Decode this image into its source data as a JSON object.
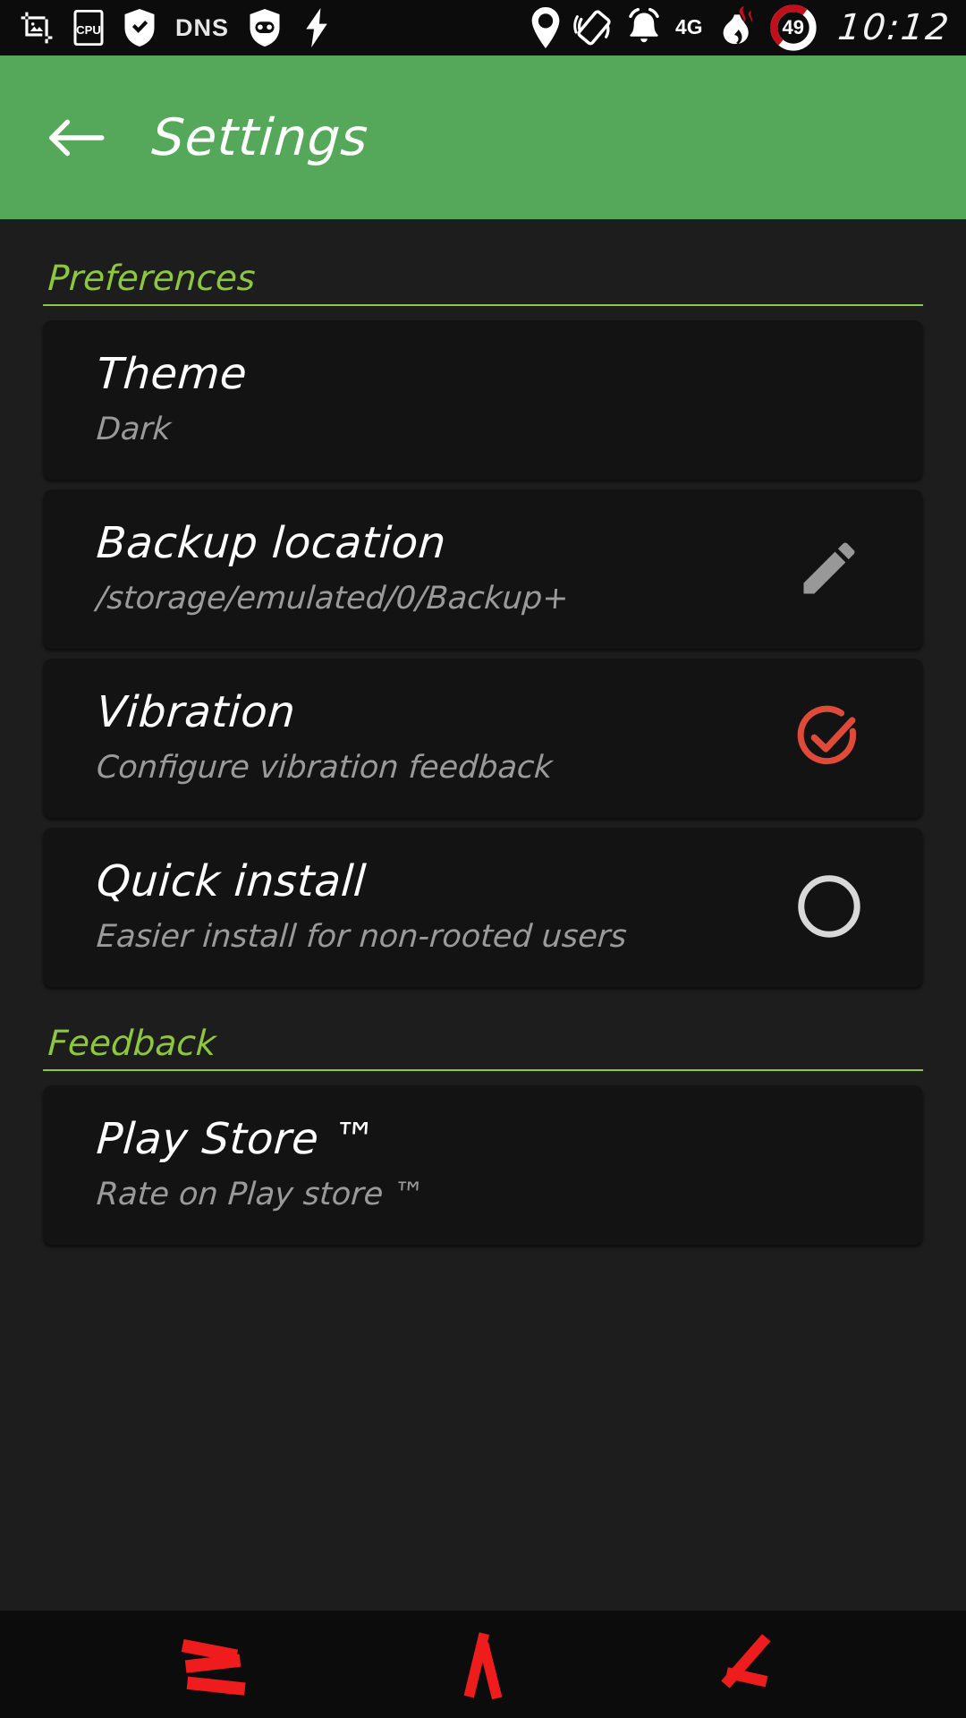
{
  "status_bar": {
    "left_icons": [
      {
        "name": "screenshot-crop-icon",
        "label": "screenshot"
      },
      {
        "name": "cpu-icon",
        "label": "CPU"
      },
      {
        "name": "shield-check-icon",
        "label": "protected"
      },
      {
        "name": "dns-icon",
        "label": "DNS"
      },
      {
        "name": "adaway-shield-icon",
        "label": "adblock"
      },
      {
        "name": "flash-icon",
        "label": "charging"
      }
    ],
    "right_icons": [
      {
        "name": "location-pin-icon",
        "label": "location"
      },
      {
        "name": "auto-rotate-icon",
        "label": "auto rotate"
      },
      {
        "name": "alarm-bell-icon",
        "label": "alarm"
      },
      {
        "name": "network-4g-icon",
        "label": "4G"
      },
      {
        "name": "burning-battery-icon",
        "label": "battery hot"
      }
    ],
    "battery_level": "49",
    "clock": "10:12",
    "battery_ring_color": "#c0101c"
  },
  "app_bar": {
    "back_label": "Back",
    "title": "Settings",
    "background": "#55a85a"
  },
  "sections": [
    {
      "id": "preferences",
      "title": "Preferences",
      "accent": "#8dc63f",
      "items": [
        {
          "id": "theme",
          "title": "Theme",
          "subtitle": "Dark",
          "action": "none"
        },
        {
          "id": "backup-location",
          "title": "Backup location",
          "subtitle": "/storage/emulated/0/Backup+",
          "action": "edit-pencil-icon"
        },
        {
          "id": "vibration",
          "title": "Vibration",
          "subtitle": "Configure vibration feedback",
          "action": "check-circle-icon",
          "checked": true,
          "check_color": "#df4a39"
        },
        {
          "id": "quick-install",
          "title": "Quick install",
          "subtitle": "Easier install for non-rooted users",
          "action": "empty-circle-icon",
          "checked": false,
          "check_color": "#d8d8d8"
        }
      ]
    },
    {
      "id": "feedback",
      "title": "Feedback",
      "accent": "#8dc63f",
      "items": [
        {
          "id": "play-store",
          "title": "Play Store ™",
          "subtitle": "Rate on Play store ™",
          "action": "none"
        }
      ]
    }
  ],
  "nav_bar": {
    "color": "#ee1c1c",
    "buttons": [
      {
        "id": "recents",
        "name": "recents-icon",
        "label": "Recents"
      },
      {
        "id": "home",
        "name": "home-icon",
        "label": "Home"
      },
      {
        "id": "back",
        "name": "back-nav-icon",
        "label": "Back"
      }
    ]
  }
}
